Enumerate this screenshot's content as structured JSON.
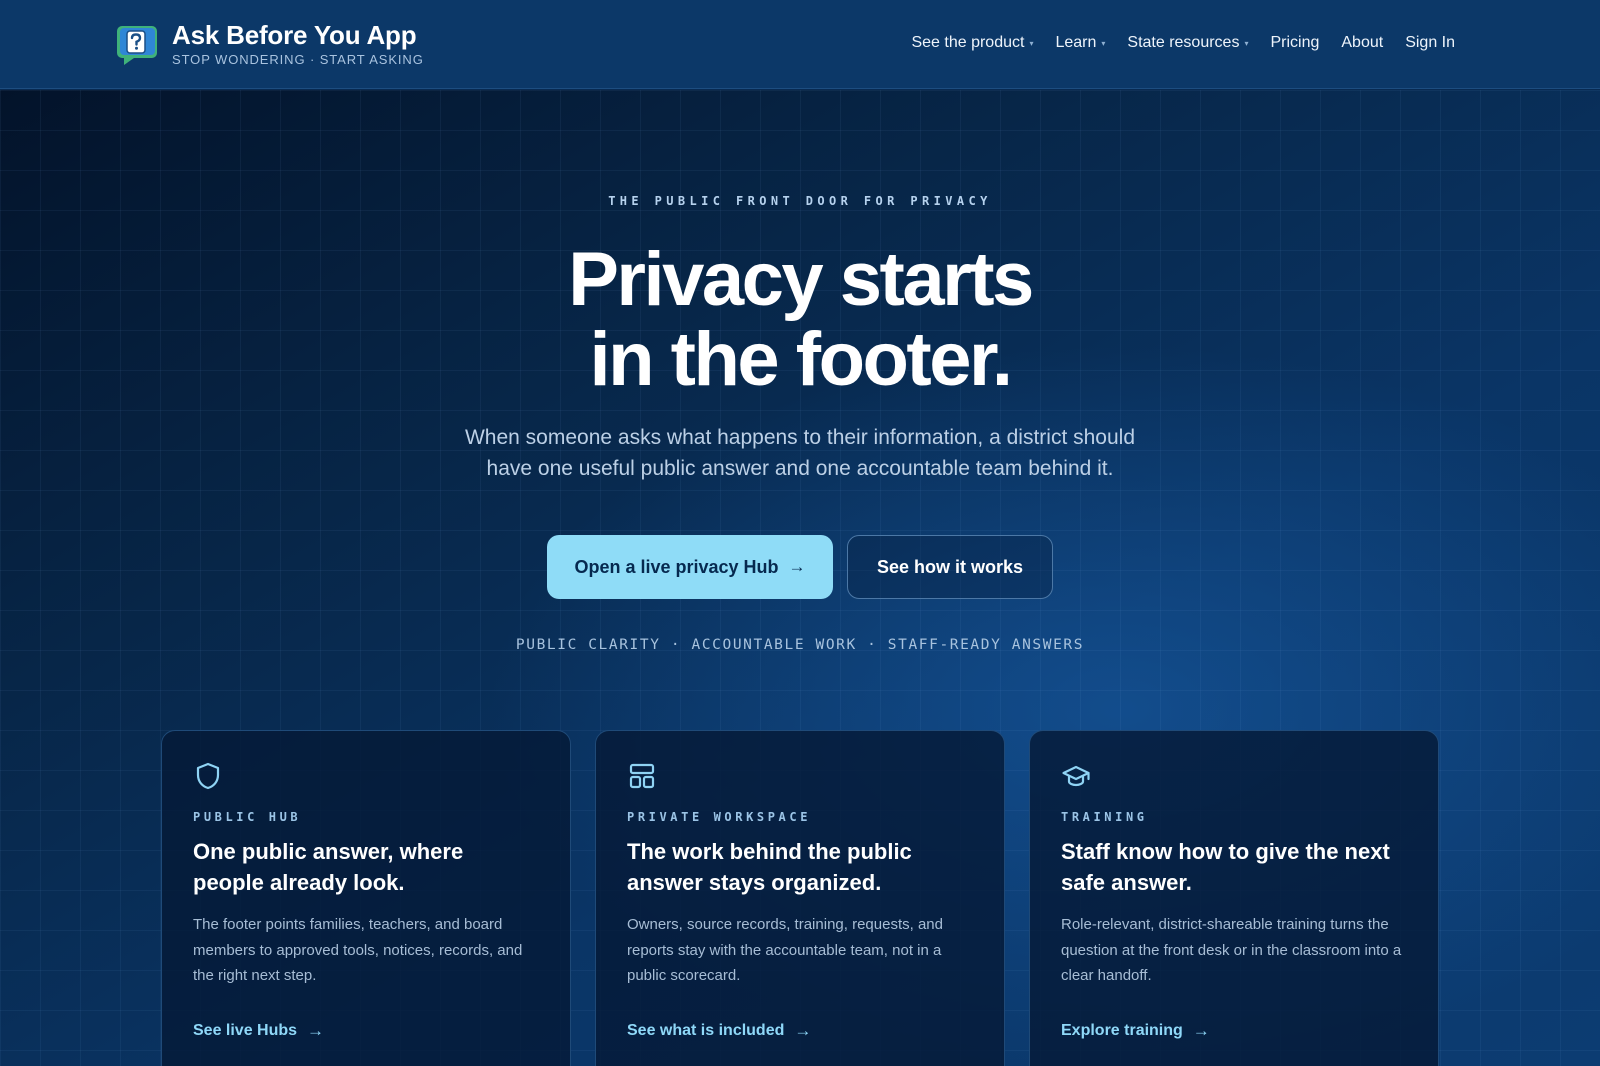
{
  "header": {
    "brand_name": "Ask Before You App",
    "brand_tagline": "STOP WONDERING · START ASKING",
    "nav": [
      {
        "label": "See the product",
        "has_menu": true
      },
      {
        "label": "Learn",
        "has_menu": true
      },
      {
        "label": "State resources",
        "has_menu": true
      },
      {
        "label": "Pricing",
        "has_menu": false
      },
      {
        "label": "About",
        "has_menu": false
      },
      {
        "label": "Sign In",
        "has_menu": false
      }
    ]
  },
  "hero": {
    "eyebrow": "THE PUBLIC FRONT DOOR FOR PRIVACY",
    "headline_line1": "Privacy starts",
    "headline_line2": "in the footer.",
    "subhead": "When someone asks what happens to their information, a district should have one useful public answer and one accountable team behind it.",
    "primary_cta": "Open a live privacy Hub",
    "secondary_cta": "See how it works",
    "tagline": "PUBLIC CLARITY · ACCOUNTABLE WORK · STAFF-READY ANSWERS"
  },
  "cards": [
    {
      "icon": "shield-icon",
      "eyebrow": "PUBLIC HUB",
      "title": "One public answer, where people already look.",
      "body": "The footer points families, teachers, and board members to approved tools, notices, records, and the right next step.",
      "link": "See live Hubs"
    },
    {
      "icon": "layout-grid-icon",
      "eyebrow": "PRIVATE WORKSPACE",
      "title": "The work behind the public answer stays organized.",
      "body": "Owners, source records, training, requests, and reports stay with the accountable team, not in a public scorecard.",
      "link": "See what is included"
    },
    {
      "icon": "graduation-cap-icon",
      "eyebrow": "TRAINING",
      "title": "Staff know how to give the next safe answer.",
      "body": "Role-relevant, district-shareable training turns the question at the front desk or in the classroom into a clear handoff.",
      "link": "Explore training"
    }
  ],
  "colors": {
    "header_bg": "#0c3868",
    "hero_dark": "#03132a",
    "hero_light": "#0c3c72",
    "accent_cyan": "#8fdcf7",
    "card_bg": "#051a37",
    "link_cyan": "#8fd8f8"
  }
}
